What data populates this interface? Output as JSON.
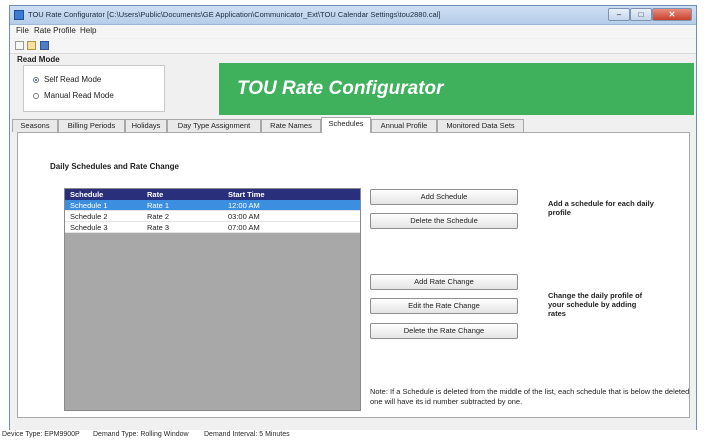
{
  "window": {
    "title": "TOU Rate Configurator [C:\\Users\\Public\\Documents\\GE Application\\Communicator_Ext\\TOU Calendar Settings\\tou2880.cal]",
    "controls": {
      "minimize": "–",
      "maximize": "□",
      "close": "✕"
    }
  },
  "menu": [
    "File",
    "Rate Profile",
    "Help"
  ],
  "toolbar_icons": [
    "new-file-icon",
    "open-file-icon",
    "save-icon"
  ],
  "read_mode": {
    "title": "Read Mode",
    "options": [
      {
        "label": "Self Read Mode",
        "selected": true
      },
      {
        "label": "Manual Read Mode",
        "selected": false
      }
    ]
  },
  "banner": {
    "title": "TOU Rate Configurator",
    "color": "#3fb05c"
  },
  "tabs": [
    "Seasons",
    "Billing Periods",
    "Holidays",
    "Day Type Assignment",
    "Rate Names",
    "Schedules",
    "Annual Profile",
    "Monitored Data Sets"
  ],
  "active_tab": "Schedules",
  "schedules_panel": {
    "section_title": "Daily Schedules and Rate Change",
    "table": {
      "columns": [
        "Schedule",
        "Rate",
        "Start Time"
      ],
      "rows": [
        [
          "Schedule 1",
          "Rate 1",
          "12:00 AM"
        ],
        [
          "Schedule 2",
          "Rate 2",
          "03:00 AM"
        ],
        [
          "Schedule 3",
          "Rate 3",
          "07:00 AM"
        ]
      ],
      "selected_row": 0
    },
    "buttons": {
      "add_schedule": "Add Schedule",
      "delete_schedule": "Delete the Schedule",
      "add_rate_change": "Add Rate Change",
      "edit_rate_change": "Edit the Rate Change",
      "delete_rate_change": "Delete the Rate Change"
    },
    "hints": {
      "schedule": "Add a schedule for each daily profile",
      "rate_change": "Change the daily profile of your schedule by adding rates"
    },
    "note": "Note: If a Schedule is deleted from the middle of the list, each schedule that is below the deleted one will have its id number subtracted by one."
  },
  "status_bar": {
    "device_type": "Device Type:  EPM9900P",
    "demand_type": "Demand Type:  Rolling Window",
    "demand_interval": "Demand Interval:  5 Minutes"
  },
  "colors": {
    "table_header": "#2a2f7c",
    "selected_row": "#3c8fe0",
    "grid_background": "#a8a8a8"
  }
}
